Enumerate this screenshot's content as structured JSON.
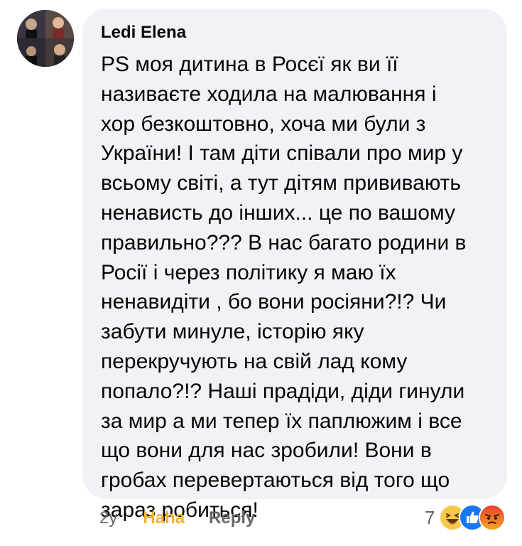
{
  "comment": {
    "author": "Ledi Elena",
    "text": "PS моя дитина в Росєї як ви її\nназиваєте ходила на малювання і\nхор безкоштовно, хоча ми були з\nУкраїни! І там діти співали про мир у\nвсьому світі, а тут дітям прививають\nненависть до інших... це по вашому\nправильно??? В нас багато родини в\nРосії і через політику я маю їх\nненавидіти , бо вони росіяни?!? Чи\nзабути минуле, історію яку\nперекручують на свій лад кому\nпопало?!? Наші прадіди, діди гинули\nза мир а ми тепер їх паплюжим і все\nщо вони для нас зробили! Вони в\nгробах перевертаються від того що\nзараз робиться!"
  },
  "actions": {
    "timestamp": "2y",
    "reaction_label": "Haha",
    "reply_label": "Reply"
  },
  "reactions": {
    "count": "7",
    "icons": [
      "haha-emoji-icon",
      "like-icon",
      "angry-emoji-icon"
    ]
  },
  "colors": {
    "bubble": "#f0f2f5",
    "haha": "#f0b232",
    "muted": "#65676b",
    "like": "#1877f2"
  }
}
